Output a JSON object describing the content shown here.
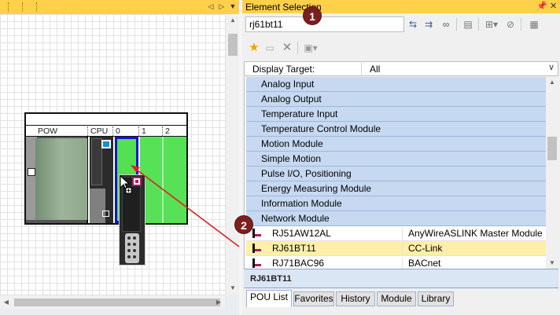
{
  "left_pane": {
    "slots": [
      "POW",
      "CPU",
      "0",
      "1",
      "2"
    ]
  },
  "right_pane": {
    "title": "Element Selection",
    "search": {
      "value": "rj61bt11"
    },
    "display_target": {
      "label": "Display Target:",
      "value": "All"
    },
    "categories": [
      "Analog Input",
      "Analog Output",
      "Temperature Input",
      "Temperature Control Module",
      "Motion Module",
      "Simple Motion",
      "Pulse I/O, Positioning",
      "Energy Measuring Module",
      "Information Module",
      "Network Module"
    ],
    "items": [
      {
        "name": "RJ51AW12AL",
        "desc": "AnyWireASLINK Master Module"
      },
      {
        "name": "RJ61BT11",
        "desc": "CC-Link"
      },
      {
        "name": "RJ71BAC96",
        "desc": "BACnet"
      }
    ],
    "selected_item": "RJ61BT11",
    "tabs": [
      "POU List",
      "Favorites",
      "History",
      "Module",
      "Library"
    ]
  },
  "callouts": [
    "1",
    "2"
  ],
  "colors": {
    "accent_title": "#ffd04a",
    "category_bg": "#c6d9f1",
    "selected_bg": "#ffefa8",
    "arrow": "#e02020"
  },
  "icons": [
    "pin-icon",
    "close-icon",
    "star-icon",
    "delete-icon",
    "search-icon"
  ]
}
